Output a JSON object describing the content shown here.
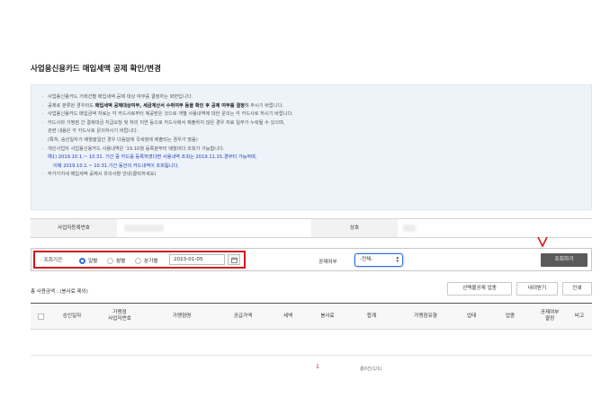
{
  "page": {
    "title": "사업용신용카드 매입세액 공제 확인/변경"
  },
  "info": {
    "lines": [
      "사업용신용카드 거래건별 매입세액 공제 대상 여부를 결정하는 화면입니다.",
      "공제로 분류된 경우라도 매입세액 공제대상여부, 세금계산서 수취여부 등을 확인 후 공제 여부를 결정해 주시기 바랍니다.",
      "사업용신용카드 매입금액 자료는 각 카드사로부터 제공받은 것으로 개별 사용내역에 대한 문의는 각 카드사로 하시기 바랍니다.",
      "카드사와 가맹점 간 결제대금 지급요청 및 처리 지연 등으로 카드사에서 제출하지 않은 경우 자료 일부가 누락될 수 있으며,",
      "관련 내용은 각 카드사로 문의하시기 바랍니다.",
      "(특히, 승인일자가 매월말일인 경우 다음달에 국세청에 제출되는 경우가 많음)",
      "개인사업자 사업용신용카드 사용내역은 '19.10월 등록분부터 매월마다 조회가 가능합니다.",
      "예1) 2019.10.1.~ 10.31. 기간 중 카드를 등록하였다면 사용내역 조회는 2019.11.15.경부터 가능하며,",
      "이때 2019.10.1.~ 10.31.기간 동안의 카드내역이 조회됩니다.",
      "부가가치세 매입세액 공제시 유의사항 안내(클릭하세요)"
    ],
    "bold_segment_1": "매입세액 공제대상여부, 세금계산서 수취여부 등을 확인 후 공제 여부를 결정"
  },
  "business": {
    "reg_no_label": "사업자등록번호",
    "name_label": "상호"
  },
  "search": {
    "period_label": "조회기간",
    "options": [
      "일별",
      "월별",
      "분기별"
    ],
    "selected_option": "일별",
    "date_value": "2023-01-05",
    "deduction_label": "공제여부",
    "deduction_value": "-전체-",
    "query_button": "조회하기",
    "annotation_mark": "V"
  },
  "results": {
    "total_label": "총 사용금액 : (봉사료 제외)",
    "buttons": {
      "select_deduct": "선택불공제 업종",
      "download": "내려받기",
      "print": "인쇄"
    },
    "columns": [
      "승인일자",
      "가맹점\n사업자번호",
      "가맹점명",
      "공급가액",
      "세액",
      "봉사료",
      "합계",
      "가맹점유형",
      "업태",
      "업종",
      "공제여부\n결정",
      "비고"
    ]
  },
  "pager": {
    "current_page": "1",
    "summary": "총0건(1/1)"
  },
  "colors": {
    "highlight_red": "#d0161d",
    "accent_blue": "#2f6fd6",
    "info_blue": "#1d3fb8"
  }
}
